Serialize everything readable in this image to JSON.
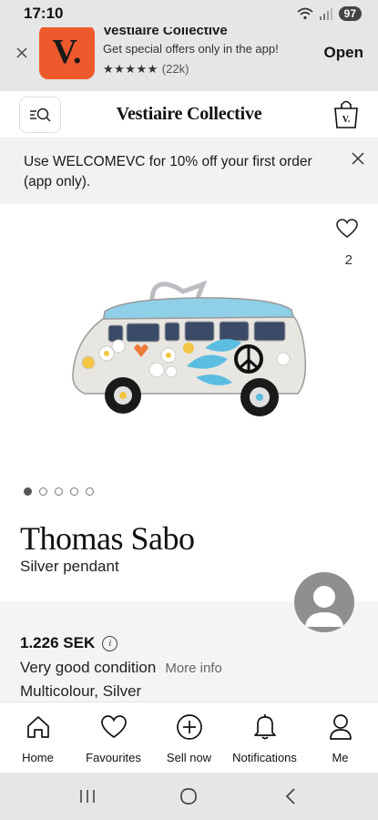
{
  "status_bar": {
    "time": "17:10",
    "battery": "97"
  },
  "app_banner": {
    "app_name": "Vestiaire Collective",
    "icon_letter": "V.",
    "tagline": "Get special offers only in the app!",
    "stars": "★★★★★",
    "rating_count": "(22k)",
    "open_label": "Open",
    "icon_color": "#ef5a2c"
  },
  "header": {
    "logo": "Vestiaire Collective"
  },
  "promo": {
    "text": "Use WELCOMEVC for 10% off your first order (app only)."
  },
  "product": {
    "favourites_count": "2",
    "brand": "Thomas Sabo",
    "title": "Silver pendant",
    "images_total": 5,
    "image_index": 1
  },
  "details": {
    "price": "1.226 SEK",
    "condition": "Very good condition",
    "more_info": "More info",
    "colours": "Multicolour, Silver"
  },
  "bottom_nav": [
    {
      "label": "Home",
      "icon": "home-icon"
    },
    {
      "label": "Favourites",
      "icon": "heart-icon"
    },
    {
      "label": "Sell now",
      "icon": "plus-circle-icon"
    },
    {
      "label": "Notifications",
      "icon": "bell-icon"
    },
    {
      "label": "Me",
      "icon": "user-icon"
    }
  ]
}
